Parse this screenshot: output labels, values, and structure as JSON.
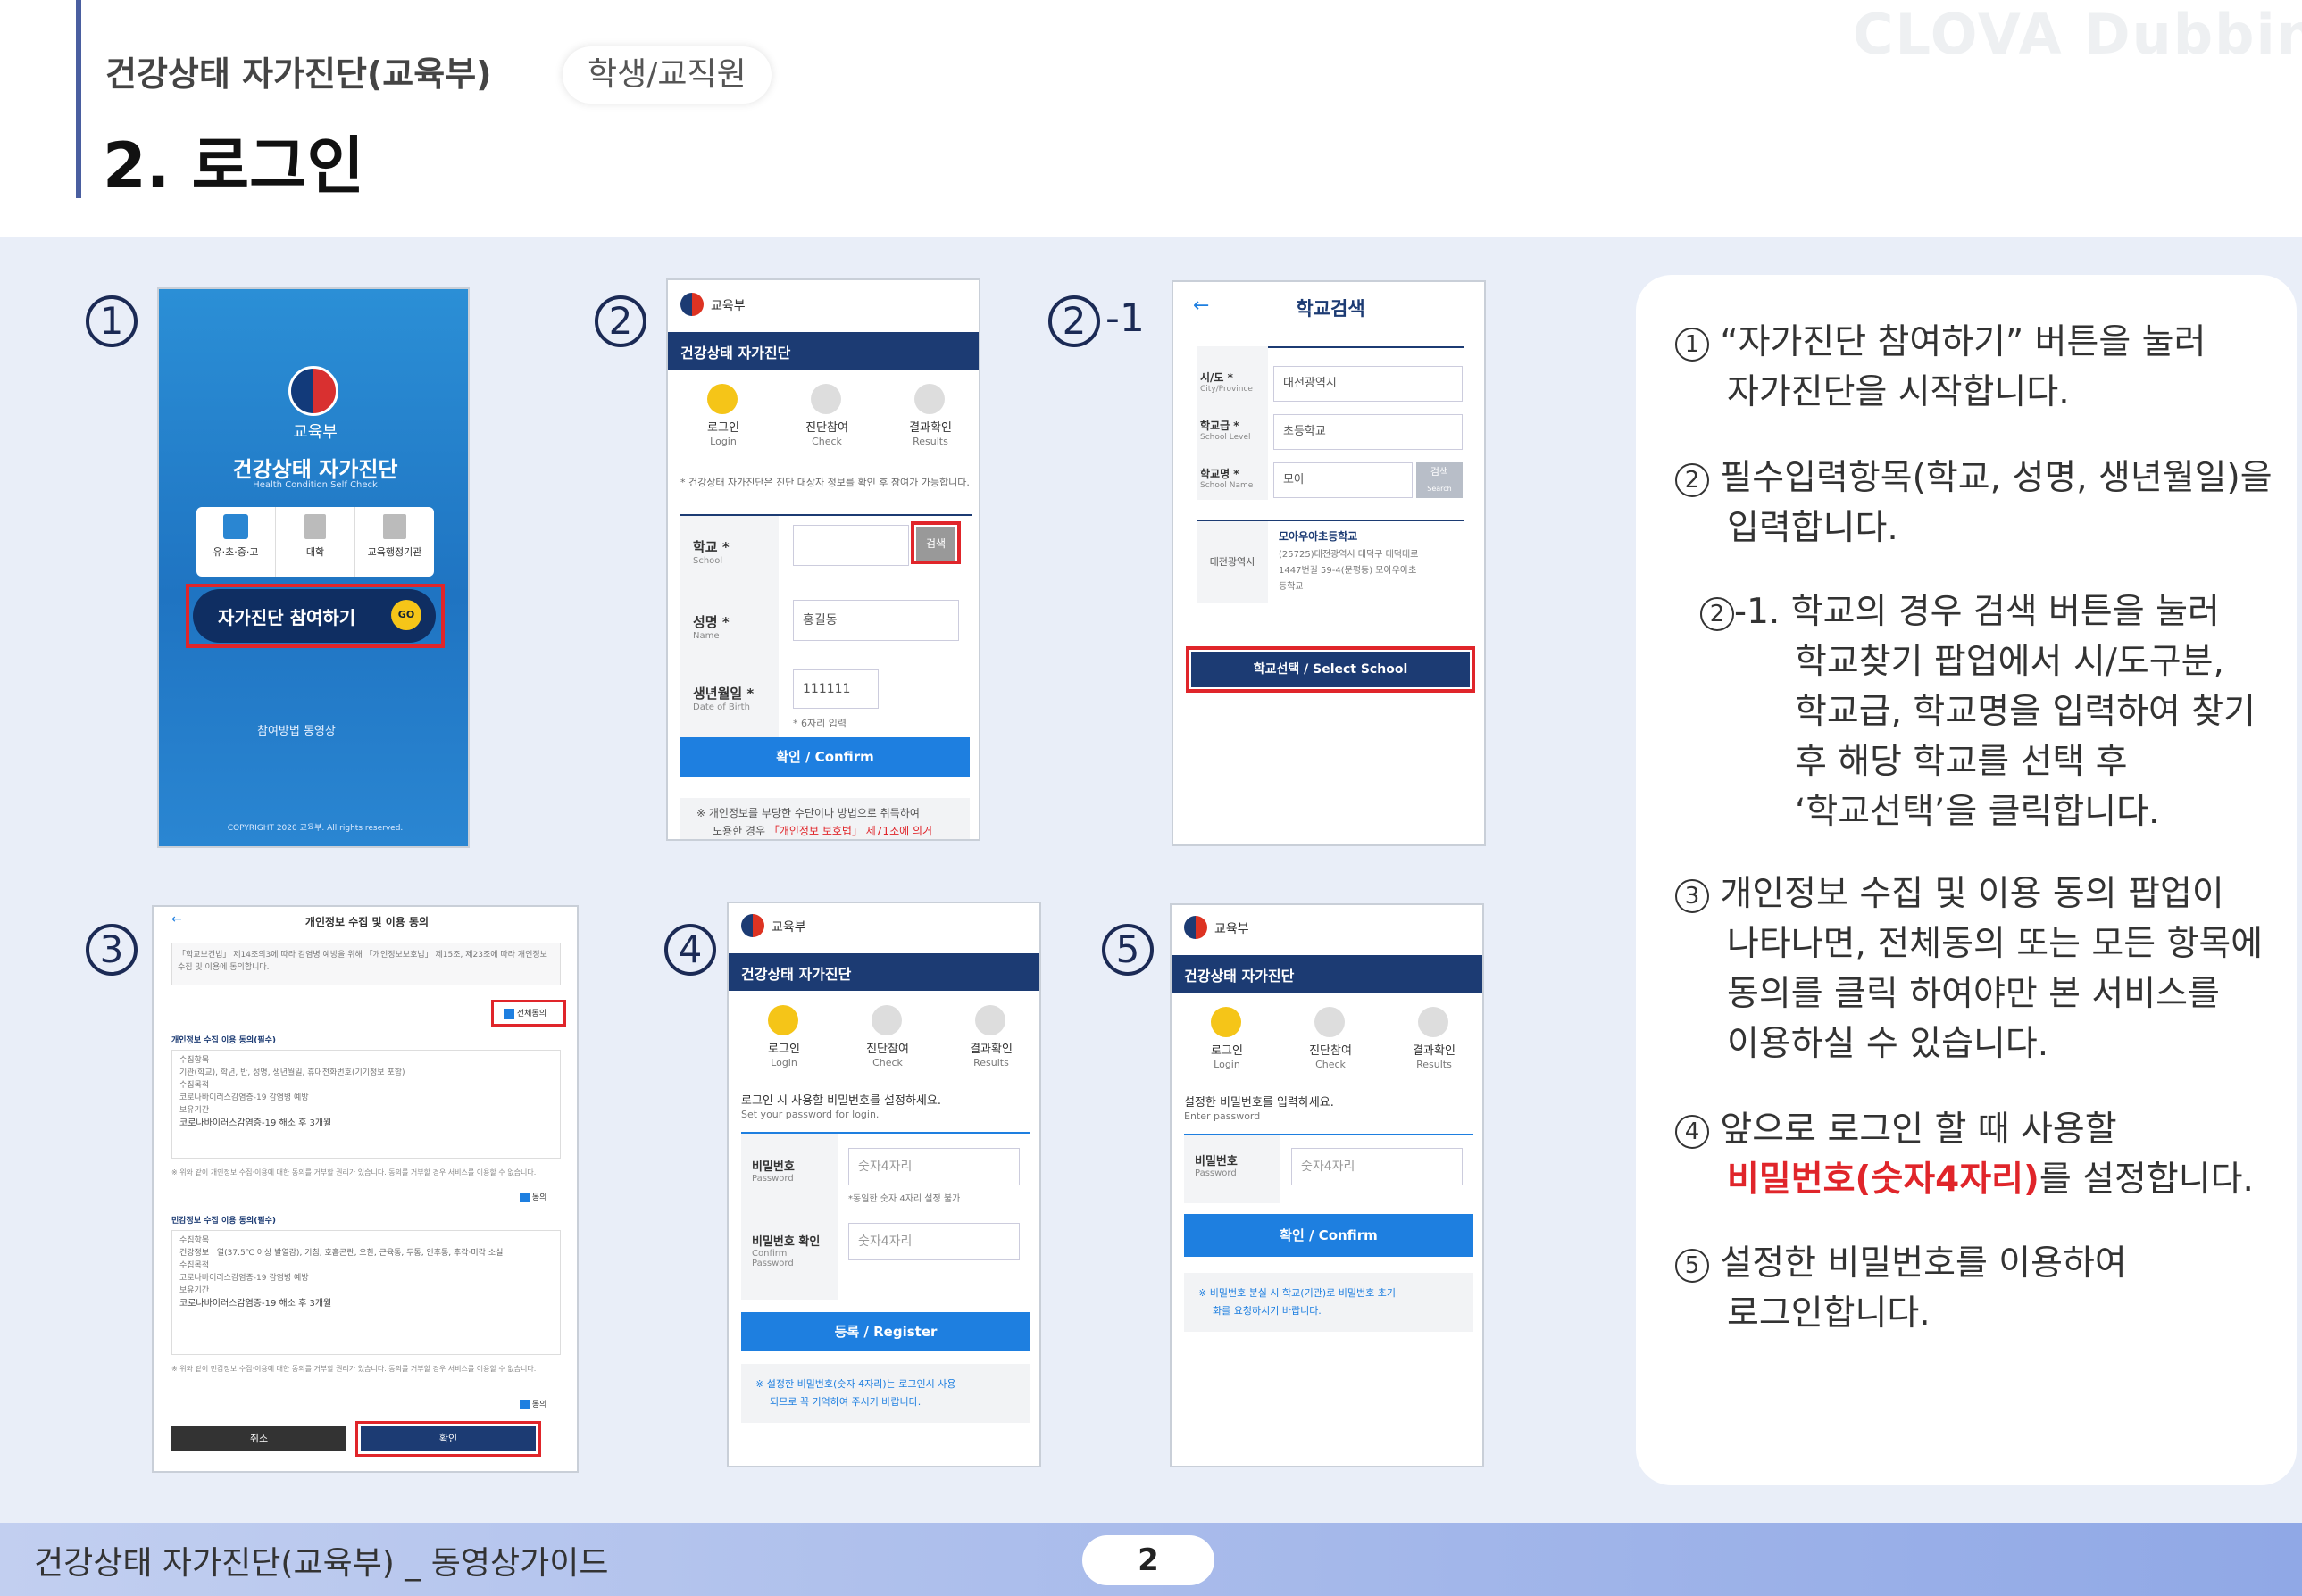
{
  "header": {
    "title": "건강상태 자가진단(교육부)",
    "badge": "학생/교직원",
    "heading": "2. 로그인",
    "watermark": "CLOVA Dubbing"
  },
  "footer": {
    "text": "건강상태 자가진단(교육부) _ 동영상가이드",
    "page": "2"
  },
  "labels": {
    "n1": "1",
    "n2": "2",
    "n2_1_circ": "2",
    "n2_1_suffix": "-1",
    "n3": "3",
    "n4": "4",
    "n5": "5"
  },
  "shot1": {
    "org": "교육부",
    "title": "건강상태 자가진단",
    "subtitle": "Health Condition Self Check",
    "tabs": [
      "유·초·중·고",
      "대학",
      "교육행정기관"
    ],
    "start_button": "자가진단 참여하기",
    "go": "GO",
    "guide": "참여방법 동영상",
    "copyright": "COPYRIGHT 2020 교육부. All rights reserved."
  },
  "shot2": {
    "org": "교육부",
    "bar": "건강상태 자가진단",
    "steps": [
      {
        "ko": "로그인",
        "en": "Login"
      },
      {
        "ko": "진단참여",
        "en": "Check"
      },
      {
        "ko": "결과확인",
        "en": "Results"
      }
    ],
    "notice": "* 건강상태 자가진단은 진단 대상자 정보를 확인 후 참여가 가능합니다.",
    "fields": [
      {
        "ko": "학교 *",
        "en": "School",
        "value": ""
      },
      {
        "ko": "성명 *",
        "en": "Name",
        "value": "홍길동"
      },
      {
        "ko": "생년월일 *",
        "en": "Date of Birth",
        "value": "111111"
      }
    ],
    "search": "검색",
    "dob_hint": "* 6자리 입력",
    "confirm": "확인 / Confirm",
    "privacy_a": "※ 개인정보를 부당한 수단이나 방법으로 취득하여",
    "privacy_b": "도용한 경우",
    "privacy_law": "「개인정보 보호법」 제71조에 의거"
  },
  "shot21": {
    "title": "학교검색",
    "back": "←",
    "rows": [
      {
        "ko": "시/도 *",
        "en": "City/Province",
        "value": "대전광역시"
      },
      {
        "ko": "학교급 *",
        "en": "School Level",
        "value": "초등학교"
      },
      {
        "ko": "학교명 *",
        "en": "School Name",
        "value": "모아"
      }
    ],
    "search": "검색",
    "search_en": "Search",
    "result_region": "대전광역시",
    "result_name": "모아우아초등학교",
    "result_addr1": "(25725)대전광역시 대덕구 대덕대로",
    "result_addr2": "1447번길 59-4(문평동) 모아우아초",
    "result_addr3": "등학교",
    "select": "학교선택 / Select School"
  },
  "shot3": {
    "title": "개인정보 수집 및 이용 동의",
    "back": "←",
    "intro": "「학교보건법」 제14조의3에 따라 감염병 예방을 위해 「개인정보보호법」 제15조, 제23조에 따라 개인정보 수집 및 이용에 동의합니다.",
    "agree_all": "전체동의",
    "sec1": "개인정보 수집 이용 동의(필수)",
    "sec1_lines": [
      "수집항목",
      "기관(학교), 학년, 반, 성명, 생년월일, 휴대전화번호(기기정보 포함)",
      "수집목적",
      "코로나바이러스감염증-19 감염병 예방",
      "보유기간",
      "코로나바이러스감염증-19 해소 후 3개월"
    ],
    "note1": "※ 위와 같이 개인정보 수집·이용에 대한 동의를 거부할 권리가 있습니다. 동의를 거부할 경우 서비스를 이용할 수 없습니다.",
    "agree": "동의",
    "sec2": "민감정보 수집 이용 동의(필수)",
    "sec2_lines": [
      "수집항목",
      "건강정보 : 열(37.5℃ 이상 발열감), 기침, 호흡곤란, 오한, 근육통, 두통, 인후통, 후각·미각 소실",
      "수집목적",
      "코로나바이러스감염증-19 감염병 예방",
      "보유기간",
      "코로나바이러스감염증-19 해소 후 3개월"
    ],
    "note2": "※ 위와 같이 민감정보 수집·이용에 대한 동의를 거부할 권리가 있습니다. 동의를 거부할 경우 서비스를 이용할 수 없습니다.",
    "cancel": "취소",
    "ok": "확인"
  },
  "shot4": {
    "org": "교육부",
    "bar": "건강상태 자가진단",
    "steps": [
      {
        "ko": "로그인",
        "en": "Login"
      },
      {
        "ko": "진단참여",
        "en": "Check"
      },
      {
        "ko": "결과확인",
        "en": "Results"
      }
    ],
    "instruction": "로그인 시 사용할 비밀번호를 설정하세요.",
    "instruction_en": "Set your password for login.",
    "pw_ko": "비밀번호",
    "pw_en": "Password",
    "pw_ph": "숫자4자리",
    "pw_hint": "*동일한 숫자 4자리 설정 불가",
    "pw2_ko": "비밀번호 확인",
    "pw2_en1": "Confirm",
    "pw2_en2": "Password",
    "pw2_ph": "숫자4자리",
    "register": "등록 / Register",
    "note_a": "※ 설정한 비밀번호(숫자 4자리)는 로그인시 사용",
    "note_b": "되므로 꼭 기억하여 주시기 바랍니다."
  },
  "shot5": {
    "org": "교육부",
    "bar": "건강상태 자가진단",
    "steps": [
      {
        "ko": "로그인",
        "en": "Login"
      },
      {
        "ko": "진단참여",
        "en": "Check"
      },
      {
        "ko": "결과확인",
        "en": "Results"
      }
    ],
    "instruction": "설정한 비밀번호를 입력하세요.",
    "instruction_en": "Enter password",
    "pw_ko": "비밀번호",
    "pw_en": "Password",
    "pw_ph": "숫자4자리",
    "confirm": "확인 / Confirm",
    "note_a": "※ 비밀번호 분실 시 학교(기관)로 비밀번호 초기",
    "note_b": "화를 요청하시기 바랍니다."
  },
  "panel": {
    "i1_num": "1",
    "i1_l1": "“자가진단 참여하기” 버튼을 눌러",
    "i1_l2": "자가진단을 시작합니다.",
    "i2_num": "2",
    "i2_l1": "필수입력항목(학교, 성명, 생년월일)을",
    "i2_l2": "입력합니다.",
    "i21_num": "2",
    "i21_suffix": "-1.",
    "i21_l1": "학교의 경우 검색 버튼을 눌러",
    "i21_l2": "학교찾기 팝업에서 시/도구분,",
    "i21_l3": "학교급, 학교명을 입력하여 찾기",
    "i21_l4": "후 해당 학교를 선택 후",
    "i21_l5": "‘학교선택’을 클릭합니다.",
    "i3_num": "3",
    "i3_l1": "개인정보 수집 및 이용 동의 팝업이",
    "i3_l2": "나타나면, 전체동의 또는 모든 항목에",
    "i3_l3": "동의를 클릭 하여야만 본 서비스를",
    "i3_l4": "이용하실 수 있습니다.",
    "i4_num": "4",
    "i4_l1": "앞으로 로그인 할 때 사용할",
    "i4_red": "비밀번호(숫자4자리)",
    "i4_l2b": "를 설정합니다.",
    "i5_num": "5",
    "i5_l1": "설정한 비밀번호를 이용하여",
    "i5_l2": "로그인합니다."
  }
}
